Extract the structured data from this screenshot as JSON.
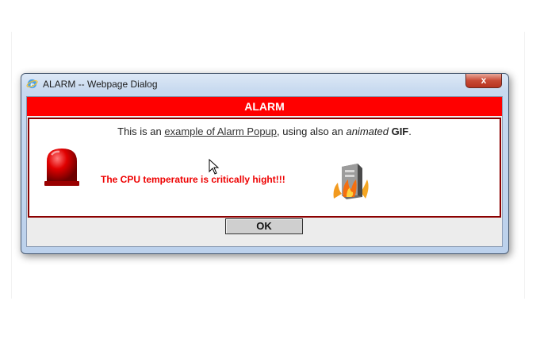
{
  "window": {
    "title": "ALARM -- Webpage Dialog",
    "close_label": "x"
  },
  "dialog": {
    "header": "ALARM",
    "intro": {
      "prefix": "This is an ",
      "link_text": "example of Alarm Popup",
      "middle": ", using also an ",
      "italic": "animated",
      "bold": "GIF",
      "suffix": "."
    },
    "warning": "The CPU temperature is critically hight!!!",
    "ok_label": "OK"
  },
  "icons": {
    "app": "internet-explorer-icon",
    "siren": "red-siren-icon",
    "computer": "burning-computer-icon",
    "pointer": "mouse-cursor-icon"
  },
  "colors": {
    "alarm_red": "#ff0000",
    "content_border": "#8b0000",
    "warning_text": "#ee0000"
  }
}
